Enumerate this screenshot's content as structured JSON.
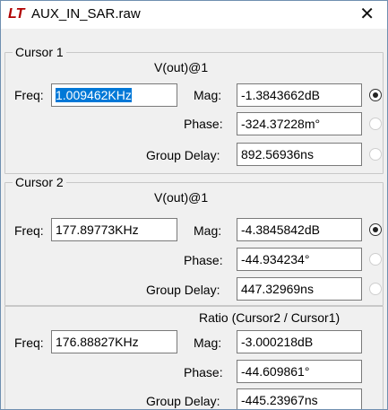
{
  "window": {
    "title": "AUX_IN_SAR.raw",
    "logo_text": "LT",
    "close_glyph": "✕"
  },
  "cursor1": {
    "group_label": "Cursor 1",
    "trace": "V(out)@1",
    "freq_label": "Freq:",
    "freq_value": "1.009462KHz",
    "mag_label": "Mag:",
    "mag_value": "-1.3843662dB",
    "phase_label": "Phase:",
    "phase_value": "-324.37228m°",
    "gd_label": "Group Delay:",
    "gd_value": "892.56936ns"
  },
  "cursor2": {
    "group_label": "Cursor 2",
    "trace": "V(out)@1",
    "freq_label": "Freq:",
    "freq_value": "177.89773KHz",
    "mag_label": "Mag:",
    "mag_value": "-4.3845842dB",
    "phase_label": "Phase:",
    "phase_value": "-44.934234°",
    "gd_label": "Group Delay:",
    "gd_value": "447.32969ns"
  },
  "ratio": {
    "header": "Ratio (Cursor2 / Cursor1)",
    "freq_label": "Freq:",
    "freq_value": "176.88827KHz",
    "mag_label": "Mag:",
    "mag_value": "-3.000218dB",
    "phase_label": "Phase:",
    "phase_value": "-44.609861°",
    "gd_label": "Group Delay:",
    "gd_value": "-445.23967ns"
  },
  "colors": {
    "selection": "#0078d7",
    "logo": "#b00000"
  }
}
